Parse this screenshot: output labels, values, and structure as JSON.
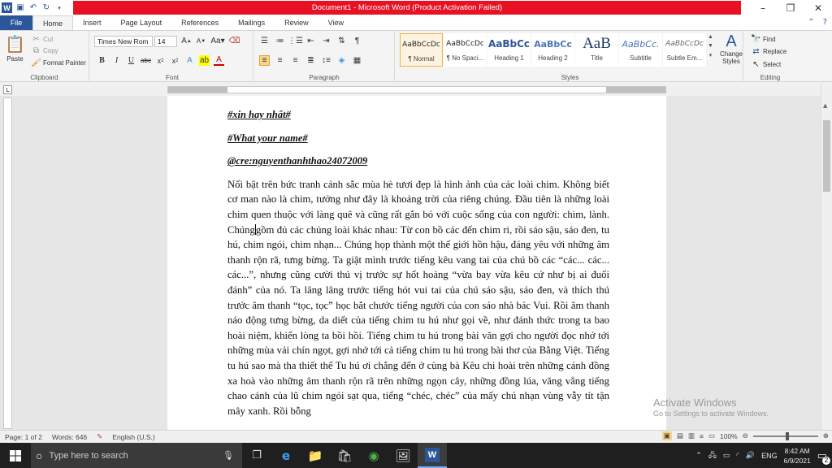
{
  "window": {
    "title": "Document1 - Microsoft Word (Product Activation Failed)",
    "controls": {
      "minimize": "–",
      "maximize": "❐",
      "close": "✕"
    }
  },
  "tabs": [
    {
      "label": "File"
    },
    {
      "label": "Home"
    },
    {
      "label": "Insert"
    },
    {
      "label": "Page Layout"
    },
    {
      "label": "References"
    },
    {
      "label": "Mailings"
    },
    {
      "label": "Review"
    },
    {
      "label": "View"
    }
  ],
  "clipboard": {
    "paste": "Paste",
    "cut": "Cut",
    "copy": "Copy",
    "format_painter": "Format Painter",
    "group": "Clipboard"
  },
  "font": {
    "name": "Times New Rom",
    "size": "14",
    "group": "Font"
  },
  "paragraph": {
    "group": "Paragraph"
  },
  "styles": {
    "group": "Styles",
    "items": [
      {
        "preview": "AaBbCcDc",
        "name": "¶ Normal"
      },
      {
        "preview": "AaBbCcDc",
        "name": "¶ No Spaci..."
      },
      {
        "preview": "AaBbCc",
        "name": "Heading 1"
      },
      {
        "preview": "AaBbCc",
        "name": "Heading 2"
      },
      {
        "preview": "AaB",
        "name": "Title"
      },
      {
        "preview": "AaBbCc.",
        "name": "Subtitle"
      },
      {
        "preview": "AaBbCcDc",
        "name": "Subtle Em..."
      }
    ],
    "change_styles": "Change Styles"
  },
  "editing": {
    "find": "Find",
    "replace": "Replace",
    "select": "Select",
    "group": "Editing"
  },
  "document": {
    "heading1": "#xin hay nhất#",
    "heading2": "#What your name#",
    "heading3": "@cre:nguyenthanhthao24072009",
    "body_before_cursor": "Nổi bật trên bức tranh cảnh sắc mùa hè tươi đẹp là hình ảnh của các loài chim. Không biết cơ man nào là chim, tưởng như đây là khoảng trời của riêng chúng. Đầu tiên là những loài chim quen thuộc với làng quê và cũng rất gắn bó với cuộc sống của con người: chim, lành. Chúng",
    "body_after_cursor": "gồm đủ các chủng loài khác nhau: Từ con bồ các đến chim ri, rồi sáo sậu, sáo đen, tu hú, chim ngói, chim nhạn... Chúng họp thành một thế giới hồn hậu, đáng yêu với những âm thanh rộn rã, tưng bừng. Ta giật mình trước tiếng kêu vang tai của chú bồ các “các... các... các...”, nhưng cũng cười thú vị trước sự hốt hoảng “vừa bay vừa kêu cứ như bị ai đuổi đánh” của nó. Ta lâng lâng trước tiếng hót vui tai của chú sáo sậu, sáo đen, và thích thú trước âm thanh “tọc, tọc” học bắt chước tiếng người của con sáo nhà bác Vui. Rồi âm thanh náo động tưng bừng, da diết của tiếng chim tu hú như gọi về, như đánh thức trong ta bao hoài niệm, khiến lòng ta bồi hồi. Tiếng chim tu hú trong bài văn gợi cho người đọc nhớ tới những mùa vải chín ngọt, gợi nhớ tới cả tiếng chim tu hú trong bài thơ của Bằng Việt. Tiếng tu hú sao mà tha thiết thế Tu hú ơi chẳng đến ở cùng bà Kêu chi hoài trên những cánh đồng xa hoà vào những âm thanh rộn rã trên những ngọn cây, những đồng lúa, văng vẳng tiếng chao cánh của lũ chim ngói sạt qua, tiếng “chéc, chéc” của mấy chú nhạn vùng vẫy tít tận mây xanh. Rồi bỗng"
  },
  "watermark": {
    "line1": "Activate Windows",
    "line2": "Go to Settings to activate Windows."
  },
  "status": {
    "page": "Page: 1 of 2",
    "words": "Words: 646",
    "language": "English (U.S.)",
    "zoom": "100%"
  },
  "taskbar": {
    "search_placeholder": "Type here to search",
    "lang": "ENG",
    "time": "8:42 AM",
    "date": "6/9/2021",
    "notifications": "2"
  }
}
